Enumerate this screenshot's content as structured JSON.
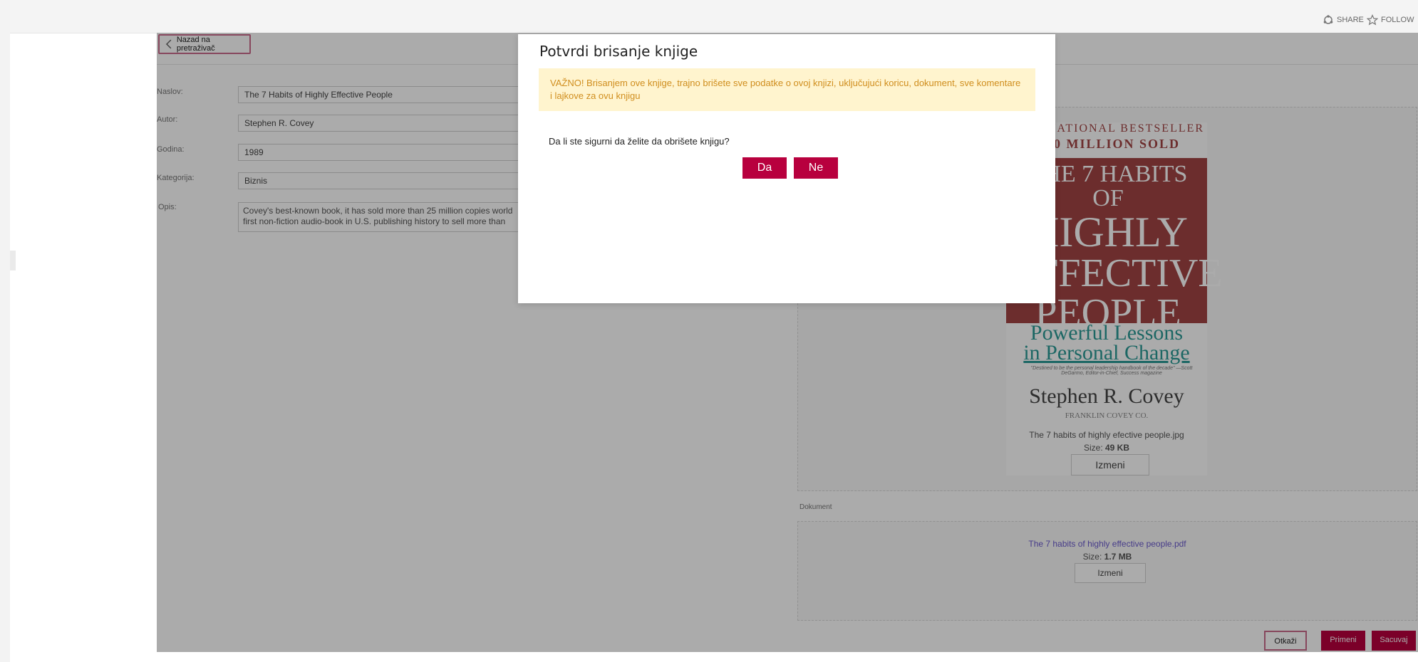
{
  "topbar": {
    "share_label": "SHARE",
    "follow_label": "FOLLOW"
  },
  "nav": {
    "back_label": "Nazad na pretraživač"
  },
  "form": {
    "title_label": "Naslov:",
    "title_value": "The 7 Habits of Highly Effective People",
    "author_label": "Autor:",
    "author_value": "Stephen R. Covey",
    "year_label": "Godina:",
    "year_value": "1989",
    "category_label": "Kategorija:",
    "category_value": "Biznis",
    "description_label": "Opis:",
    "description_line1": "Covey's best-known book, it has sold more than 25 million copies world",
    "description_line2": "first non-fiction audio-book in U.S. publishing history to sell more than"
  },
  "cover": {
    "line1": "NATIONAL BESTSELLER",
    "line2": "10 MILLION SOLD",
    "title_1": "THE 7 HABITS OF",
    "title_2": "HIGHLY",
    "title_3": "EFFECTIVE",
    "title_4": "PEOPLE",
    "subtitle_1": "Powerful Lessons",
    "subtitle_2": "in Personal Change",
    "quote": "\"Destined to be the personal leadership handbook of the decade\" —Scott DeGarmo, Editor-in-Chief, Success magazine",
    "author": "Stephen R. Covey",
    "publisher": "FRANKLIN COVEY CO.",
    "file_name": "The 7 habits of highly efective people.jpg",
    "file_size_label": "Size:",
    "file_size_value": "49 KB",
    "change_label": "Izmeni"
  },
  "document": {
    "section_label": "Dokument",
    "file_name": "The 7 habits of highly effective people.pdf",
    "file_size_label": "Size:",
    "file_size_value": "1.7 MB",
    "change_label": "Izmeni"
  },
  "footer": {
    "cancel_label": "Otkaži",
    "apply_label": "Primeni",
    "save_label": "Sacuvaj"
  },
  "modal": {
    "title": "Potvrdi brisanje knjige",
    "warning_line1": "VAŽNO! Brisanjem ove knjige, trajno brišete sve podatke o ovoj knjizi, uključujući koricu, dokument, sve komentare",
    "warning_line2": "i lajkove za ovu knjigu",
    "question": "Da li ste sigurni da želite da obrišete knjigu?",
    "yes_label": "Da",
    "no_label": "Ne"
  },
  "colors": {
    "accent": "#b8003e",
    "warning_bg": "#fff4ce",
    "warning_text": "#d08e1e",
    "cover_band": "#a24343",
    "cover_teal": "#2b9a95"
  }
}
